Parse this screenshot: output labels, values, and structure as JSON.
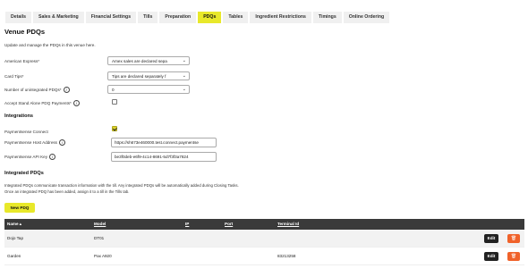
{
  "tabs": [
    {
      "label": "Details"
    },
    {
      "label": "Sales & Marketing"
    },
    {
      "label": "Financial Settings"
    },
    {
      "label": "Tills"
    },
    {
      "label": "Preparation"
    },
    {
      "label": "PDQs",
      "active": true
    },
    {
      "label": "Tables"
    },
    {
      "label": "Ingredient Restrictions"
    },
    {
      "label": "Timings"
    },
    {
      "label": "Online Ordering"
    }
  ],
  "page": {
    "title": "Venue PDQs",
    "description": "Update and manage the PDQs in this venue here."
  },
  "settings": {
    "amex_label": "American Express*",
    "amex_value": "Amex sales are declared sepa",
    "card_tips_label": "Card Tips*",
    "card_tips_value": "Tips are declared separately f",
    "unintegrated_label": "Number of unintegrated PDQs*",
    "unintegrated_value": "0",
    "standalone_label": "Accept Stand Alone PDQ Payments*",
    "standalone_checked": false
  },
  "integrations": {
    "title": "Integrations",
    "connect_label": "Paymentsense Connect",
    "connect_checked": true,
    "host_label": "Paymentsense Host Address",
    "host_value": "https://sh673e460000.test.connect.paymentse",
    "key_label": "Paymentsense API Key",
    "key_value": "be3f0deb-e6f9-4c14-8691-5d7f3f3a7824"
  },
  "integrated": {
    "title": "Integrated PDQs",
    "note_line1": "Integrated PDQs communicate transaction information with the till. Any integrated PDQs will be automatically added during Closing Tasks.",
    "note_line2": "Once an integrated PDQ has been added, assign it to a till in the Tills tab.",
    "new_button": "New PDQ"
  },
  "table": {
    "headers": {
      "name": "Name ▴",
      "model": "Model",
      "ip": "IP",
      "port": "Port",
      "terminal_id": "Terminal Id"
    },
    "rows": [
      {
        "name": "Dojo Tap",
        "model": "DT01",
        "ip": "",
        "port": "",
        "terminal_id": "",
        "edit": "Edit"
      },
      {
        "name": "Garden",
        "model": "Pax A920",
        "ip": "",
        "port": "",
        "terminal_id": "83213258",
        "edit": "Edit"
      }
    ]
  },
  "icons": {
    "info": "info-icon",
    "select_chevron": "chevron-down-icon",
    "delete": "trash-icon"
  },
  "colors": {
    "accent": "#e8e82a",
    "table_header": "#3a3a3a",
    "delete": "#f0622a"
  }
}
